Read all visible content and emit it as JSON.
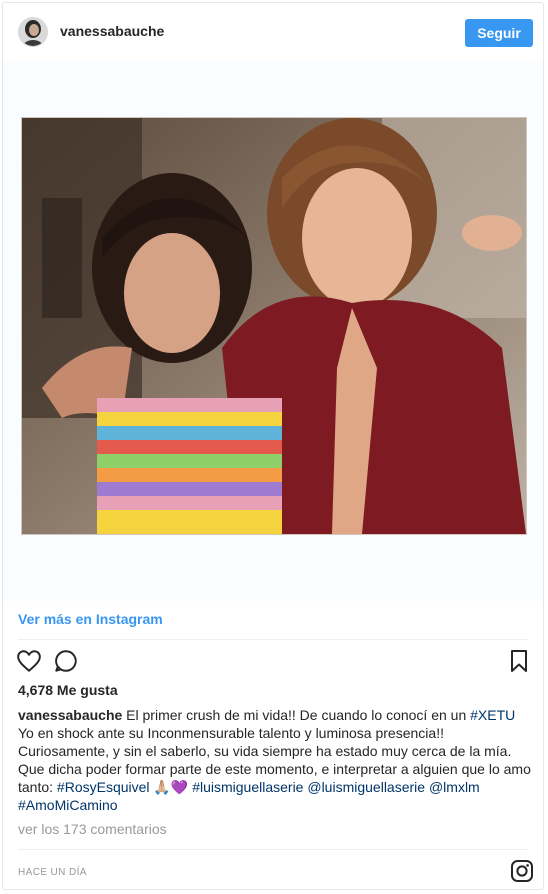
{
  "header": {
    "username": "vanessabauche",
    "follow_label": "Seguir"
  },
  "media": {
    "description_icon": "photo-two-children"
  },
  "view_more_label": "Ver más en Instagram",
  "actions": {
    "like_icon": "heart-icon",
    "comment_icon": "comment-icon",
    "save_icon": "bookmark-icon"
  },
  "likes_text": "4,678 Me gusta",
  "caption": {
    "username": "vanessabauche",
    "text_1": " El primer crush de mi vida!! De cuando lo conocí en un ",
    "tag_xetu": "#XETU",
    "text_2": " Yo en shock ante su Inconmensurable talento y luminosa presencia!! Curiosamente, y sin el saberlo, su vida siempre ha estado muy cerca de la mía. Que dicha poder formar parte de este momento, e interpretar a alguien que lo amo tanto: ",
    "tag_rosy": "#RosyEsquivel",
    "emoji": " 🙏🏼💜 ",
    "tag_serie": "#luismiguellaserie",
    "mention_serie": "@luismiguellaserie",
    "mention_lmxlm": "@lmxlm",
    "tag_camino": "#AmoMiCamino"
  },
  "comments_link": "ver los 173 comentarios",
  "timestamp": "HACE UN DÍA",
  "colors": {
    "accent": "#3897f0",
    "link": "#003569",
    "muted": "#999999"
  }
}
